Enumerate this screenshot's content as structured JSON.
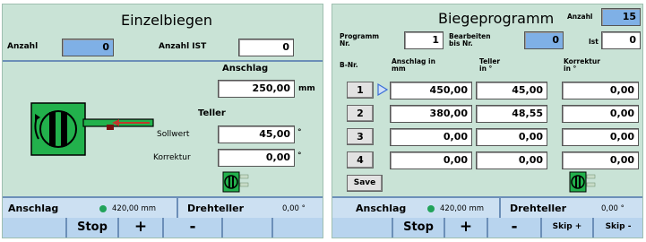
{
  "left": {
    "title": "Einzelbiegen",
    "anzahl_label": "Anzahl",
    "anzahl_value": "0",
    "anzahl_ist_label": "Anzahl IST",
    "anzahl_ist_value": "0",
    "anschlag_label": "Anschlag",
    "anschlag_value": "250,00",
    "anschlag_unit": "mm",
    "teller_label": "Teller",
    "sollwert_label": "Sollwert",
    "sollwert_value": "45,00",
    "sollwert_unit": "°",
    "korrektur_label": "Korrektur",
    "korrektur_value": "0,00",
    "korrektur_unit": "°",
    "status": {
      "anschlag_label": "Anschlag",
      "anschlag_value": "420,00 mm",
      "drehteller_label": "Drehteller",
      "drehteller_value": "0,00 °"
    },
    "buttons": [
      "",
      "Stop",
      "+",
      "-",
      "",
      ""
    ]
  },
  "right": {
    "title": "Biegeprogramm",
    "anzahl_label": "Anzahl",
    "anzahl_value": "15",
    "programm_label": "Programm Nr.",
    "programm_value": "1",
    "bearbeiten_label": "Bearbeiten bis Nr.",
    "bearbeiten_value": "0",
    "ist_label": "Ist",
    "ist_value": "0",
    "col_bnr": "B-Nr.",
    "col_anschlag": "Anschlag in mm",
    "col_teller": "Teller in °",
    "col_korrektur": "Korrektur in °",
    "rows": [
      {
        "nr": "1",
        "anschlag": "450,00",
        "teller": "45,00",
        "korrektur": "0,00"
      },
      {
        "nr": "2",
        "anschlag": "380,00",
        "teller": "48,55",
        "korrektur": "0,00"
      },
      {
        "nr": "3",
        "anschlag": "0,00",
        "teller": "0,00",
        "korrektur": "0,00"
      },
      {
        "nr": "4",
        "anschlag": "0,00",
        "teller": "0,00",
        "korrektur": "0,00"
      }
    ],
    "save_label": "Save",
    "status": {
      "anschlag_label": "Anschlag",
      "anschlag_value": "420,00 mm",
      "drehteller_label": "Drehteller",
      "drehteller_value": "0,00 °"
    },
    "buttons": [
      "",
      "Stop",
      "+",
      "-",
      "Skip +",
      "Skip -"
    ]
  },
  "colors": {
    "panel_bg": "#c9e3d6",
    "field_blue": "#7fb0e6",
    "status_bg": "#cce0f2",
    "button_bar": "#b8d4ee",
    "machine_green": "#22b14c",
    "ok_dot": "#22a35a",
    "arrow_red": "#c0392b"
  },
  "icons": [
    "bending-machine-icon",
    "small-machine-icon",
    "current-row-arrow-icon",
    "status-ok-dot"
  ]
}
